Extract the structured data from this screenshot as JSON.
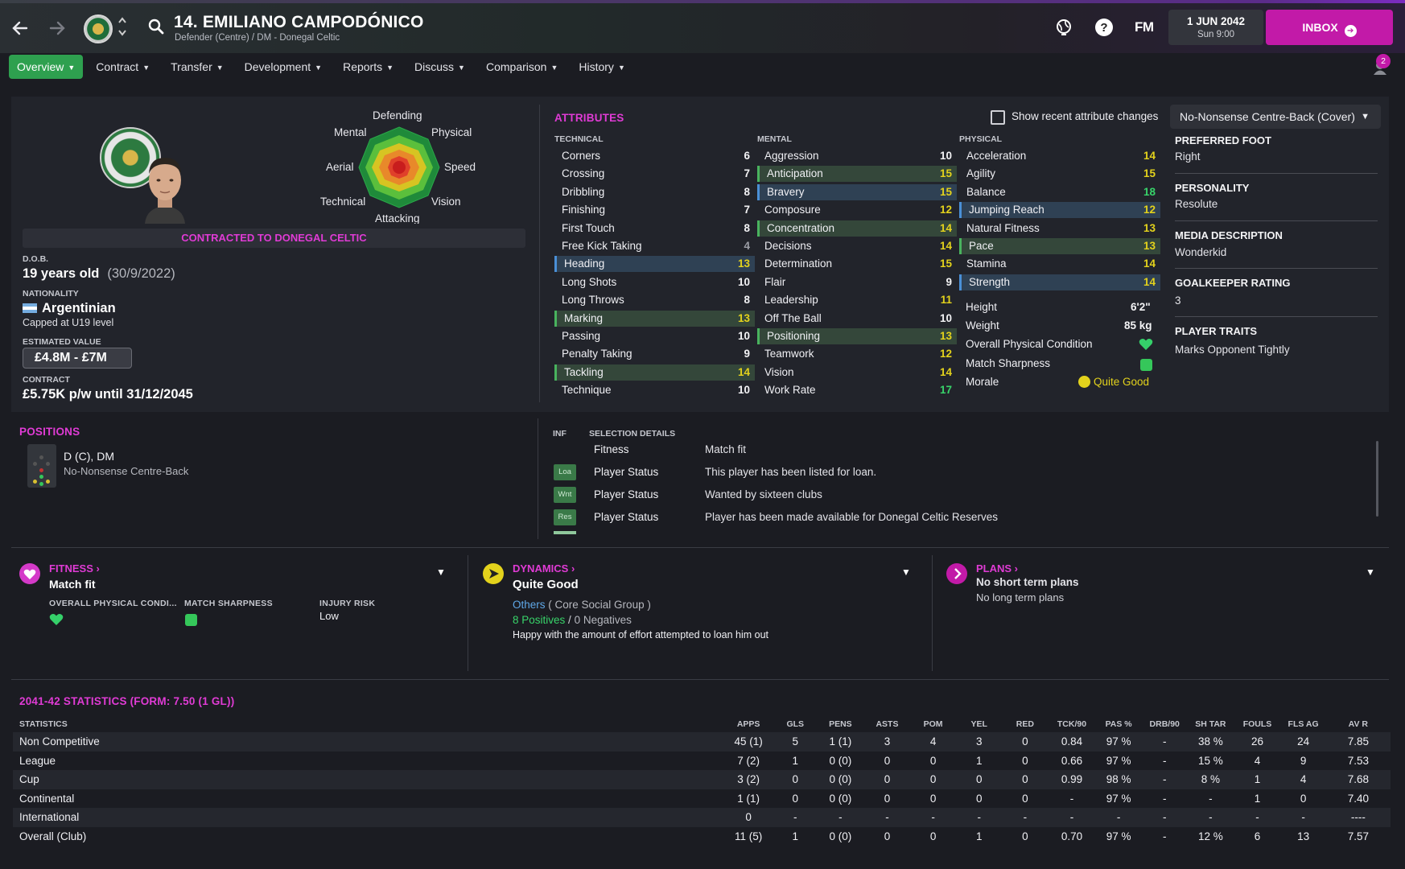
{
  "header": {
    "player_title": "14. EMILIANO CAMPODÓNICO",
    "player_subtitle": "Defender (Centre) / DM - Donegal Celtic",
    "fm_logo": "FM",
    "date": "1 JUN 2042",
    "time": "Sun 9:00",
    "inbox_label": "INBOX",
    "notification_count": "2"
  },
  "tabs": [
    {
      "label": "Overview"
    },
    {
      "label": "Contract"
    },
    {
      "label": "Transfer"
    },
    {
      "label": "Development"
    },
    {
      "label": "Reports"
    },
    {
      "label": "Discuss"
    },
    {
      "label": "Comparison"
    },
    {
      "label": "History"
    }
  ],
  "radar": {
    "labels": {
      "top": "Defending",
      "top_left": "Mental",
      "top_right": "Physical",
      "left": "Aerial",
      "right": "Speed",
      "bottom_left": "Technical",
      "bottom_right": "Vision",
      "bottom": "Attacking"
    }
  },
  "profile": {
    "contract_banner": "CONTRACTED TO DONEGAL CELTIC",
    "dob_label": "D.O.B.",
    "dob_value": "19 years old",
    "dob_date": "(30/9/2022)",
    "nationality_label": "NATIONALITY",
    "nationality_value": "Argentinian",
    "nationality_sub": "Capped at U19 level",
    "value_label": "ESTIMATED VALUE",
    "value": "£4.8M - £7M",
    "contract_label": "CONTRACT",
    "contract_value": "£5.75K p/w until 31/12/2045"
  },
  "attributes": {
    "title": "ATTRIBUTES",
    "show_recent_label": "Show recent attribute changes",
    "role_select": "No-Nonsense Centre-Back (Cover)",
    "technical_title": "TECHNICAL",
    "mental_title": "MENTAL",
    "physical_title": "PHYSICAL",
    "technical": [
      {
        "name": "Corners",
        "value": "6"
      },
      {
        "name": "Crossing",
        "value": "7"
      },
      {
        "name": "Dribbling",
        "value": "8"
      },
      {
        "name": "Finishing",
        "value": "7"
      },
      {
        "name": "First Touch",
        "value": "8"
      },
      {
        "name": "Free Kick Taking",
        "value": "4"
      },
      {
        "name": "Heading",
        "value": "13"
      },
      {
        "name": "Long Shots",
        "value": "10"
      },
      {
        "name": "Long Throws",
        "value": "8"
      },
      {
        "name": "Marking",
        "value": "13"
      },
      {
        "name": "Passing",
        "value": "10"
      },
      {
        "name": "Penalty Taking",
        "value": "9"
      },
      {
        "name": "Tackling",
        "value": "14"
      },
      {
        "name": "Technique",
        "value": "10"
      }
    ],
    "mental": [
      {
        "name": "Aggression",
        "value": "10"
      },
      {
        "name": "Anticipation",
        "value": "15"
      },
      {
        "name": "Bravery",
        "value": "15"
      },
      {
        "name": "Composure",
        "value": "12"
      },
      {
        "name": "Concentration",
        "value": "14"
      },
      {
        "name": "Decisions",
        "value": "14"
      },
      {
        "name": "Determination",
        "value": "15"
      },
      {
        "name": "Flair",
        "value": "9"
      },
      {
        "name": "Leadership",
        "value": "11"
      },
      {
        "name": "Off The Ball",
        "value": "10"
      },
      {
        "name": "Positioning",
        "value": "13"
      },
      {
        "name": "Teamwork",
        "value": "12"
      },
      {
        "name": "Vision",
        "value": "14"
      },
      {
        "name": "Work Rate",
        "value": "17"
      }
    ],
    "physical": [
      {
        "name": "Acceleration",
        "value": "14"
      },
      {
        "name": "Agility",
        "value": "15"
      },
      {
        "name": "Balance",
        "value": "18"
      },
      {
        "name": "Jumping Reach",
        "value": "12"
      },
      {
        "name": "Natural Fitness",
        "value": "13"
      },
      {
        "name": "Pace",
        "value": "13"
      },
      {
        "name": "Stamina",
        "value": "14"
      },
      {
        "name": "Strength",
        "value": "14"
      }
    ],
    "physical_info": {
      "height_label": "Height",
      "height_value": "6'2\"",
      "weight_label": "Weight",
      "weight_value": "85 kg",
      "condition_label": "Overall Physical Condition",
      "sharpness_label": "Match Sharpness",
      "morale_label": "Morale",
      "morale_value": "Quite Good"
    }
  },
  "side_info": {
    "foot_label": "PREFERRED FOOT",
    "foot_value": "Right",
    "personality_label": "PERSONALITY",
    "personality_value": "Resolute",
    "media_label": "MEDIA DESCRIPTION",
    "media_value": "Wonderkid",
    "gk_label": "GOALKEEPER RATING",
    "gk_value": "3",
    "traits_label": "PLAYER TRAITS",
    "traits_value": "Marks Opponent Tightly"
  },
  "positions": {
    "title": "POSITIONS",
    "value": "D (C), DM",
    "role": "No-Nonsense Centre-Back"
  },
  "selection": {
    "inf_header": "INF",
    "details_header": "SELECTION DETAILS",
    "rows": [
      {
        "tag": "",
        "type": "Fitness",
        "text": "Match fit"
      },
      {
        "tag": "Loa",
        "type": "Player Status",
        "text": "This player has been listed for loan."
      },
      {
        "tag": "Wnt",
        "type": "Player Status",
        "text": "Wanted by sixteen clubs"
      },
      {
        "tag": "Res",
        "type": "Player Status",
        "text": "Player has been made available for Donegal Celtic Reserves"
      }
    ]
  },
  "fitness_card": {
    "title": "FITNESS",
    "main": "Match fit",
    "col1_label": "OVERALL PHYSICAL CONDI...",
    "col2_label": "MATCH SHARPNESS",
    "col3_label": "INJURY RISK",
    "col3_value": "Low"
  },
  "dynamics_card": {
    "title": "DYNAMICS",
    "main": "Quite Good",
    "group_name": "Others",
    "group_note": "( Core Social Group )",
    "positives": "8 Positives",
    "slash": "/",
    "negatives": "0 Negatives",
    "note": "Happy with the amount of effort attempted to loan him out"
  },
  "plans_card": {
    "title": "PLANS",
    "main": "No short term plans",
    "sub": "No long term plans"
  },
  "stats": {
    "title": "2041-42 STATISTICS (FORM: 7.50 (1 GL))",
    "columns": [
      "STATISTICS",
      "APPS",
      "GLS",
      "PENS",
      "ASTS",
      "POM",
      "YEL",
      "RED",
      "TCK/90",
      "PAS %",
      "DRB/90",
      "SH TAR",
      "FOULS",
      "FLS AG",
      "AV R"
    ],
    "rows": [
      [
        "Non Competitive",
        "45 (1)",
        "5",
        "1 (1)",
        "3",
        "4",
        "3",
        "0",
        "0.84",
        "97 %",
        "-",
        "38 %",
        "26",
        "24",
        "7.85"
      ],
      [
        "League",
        "7 (2)",
        "1",
        "0 (0)",
        "0",
        "0",
        "1",
        "0",
        "0.66",
        "97 %",
        "-",
        "15 %",
        "4",
        "9",
        "7.53"
      ],
      [
        "Cup",
        "3 (2)",
        "0",
        "0 (0)",
        "0",
        "0",
        "0",
        "0",
        "0.99",
        "98 %",
        "-",
        "8 %",
        "1",
        "4",
        "7.68"
      ],
      [
        "Continental",
        "1 (1)",
        "0",
        "0 (0)",
        "0",
        "0",
        "0",
        "0",
        "-",
        "97 %",
        "-",
        "-",
        "1",
        "0",
        "7.40"
      ],
      [
        "International",
        "0",
        "-",
        "-",
        "-",
        "-",
        "-",
        "-",
        "-",
        "-",
        "-",
        "-",
        "-",
        "-",
        "----"
      ],
      [
        "Overall (Club)",
        "11 (5)",
        "1",
        "0 (0)",
        "0",
        "0",
        "1",
        "0",
        "0.70",
        "97 %",
        "-",
        "12 %",
        "6",
        "13",
        "7.57"
      ]
    ]
  },
  "colors": {
    "accent_magenta": "#e03bd5",
    "active_green": "#2ea04f",
    "inbox": "#c21aa8",
    "attr_green": "#38d46a",
    "attr_yellow": "#e3d21c"
  }
}
